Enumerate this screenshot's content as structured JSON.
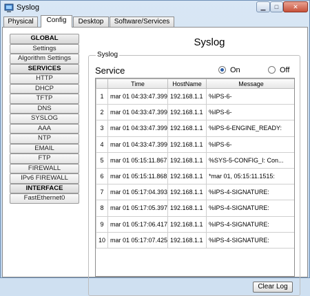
{
  "window": {
    "title": "Syslog",
    "icon": "syslog-app-icon",
    "controls": [
      "minimize",
      "maximize",
      "close"
    ]
  },
  "tabs": [
    {
      "label": "Physical"
    },
    {
      "label": "Config",
      "active": true
    },
    {
      "label": "Desktop"
    },
    {
      "label": "Software/Services"
    }
  ],
  "sidebar": {
    "items": [
      {
        "label": "GLOBAL",
        "header": true
      },
      {
        "label": "Settings"
      },
      {
        "label": "Algorithm Settings"
      },
      {
        "label": "SERVICES",
        "header": true
      },
      {
        "label": "HTTP"
      },
      {
        "label": "DHCP"
      },
      {
        "label": "TFTP"
      },
      {
        "label": "DNS"
      },
      {
        "label": "SYSLOG"
      },
      {
        "label": "AAA"
      },
      {
        "label": "NTP"
      },
      {
        "label": "EMAIL"
      },
      {
        "label": "FTP"
      },
      {
        "label": "FIREWALL"
      },
      {
        "label": "IPv6 FIREWALL"
      },
      {
        "label": "INTERFACE",
        "header": true
      },
      {
        "label": "FastEthernet0"
      }
    ]
  },
  "panel": {
    "title": "Syslog",
    "group_label": "Syslog",
    "service_label": "Service",
    "radio_on": "On",
    "radio_off": "Off",
    "selected": "On"
  },
  "table": {
    "headers": [
      "",
      "Time",
      "HostName",
      "Message"
    ],
    "rows": [
      {
        "idx": "1",
        "time": "mar 01 04:33:47.399",
        "host": "192.168.1.1",
        "message": "%IPS-6-"
      },
      {
        "idx": "2",
        "time": "mar 01 04:33:47.399",
        "host": "192.168.1.1",
        "message": "%IPS-6-"
      },
      {
        "idx": "3",
        "time": "mar 01 04:33:47.399",
        "host": "192.168.1.1",
        "message": "%IPS-6-ENGINE_READY:"
      },
      {
        "idx": "4",
        "time": "mar 01 04:33:47.399",
        "host": "192.168.1.1",
        "message": "%IPS-6-"
      },
      {
        "idx": "5",
        "time": "mar 01 05:15:11.867",
        "host": "192.168.1.1",
        "message": "%SYS-5-CONFIG_I: Con..."
      },
      {
        "idx": "6",
        "time": "mar 01 05:15:11.868",
        "host": "192.168.1.1",
        "message": "*mar 01, 05:15:11.1515:"
      },
      {
        "idx": "7",
        "time": "mar 01 05:17:04.393",
        "host": "192.168.1.1",
        "message": "%IPS-4-SIGNATURE:"
      },
      {
        "idx": "8",
        "time": "mar 01 05:17:05.397",
        "host": "192.168.1.1",
        "message": "%IPS-4-SIGNATURE:"
      },
      {
        "idx": "9",
        "time": "mar 01 05:17:06.417",
        "host": "192.168.1.1",
        "message": "%IPS-4-SIGNATURE:"
      },
      {
        "idx": "10",
        "time": "mar 01 05:17:07.425",
        "host": "192.168.1.1",
        "message": "%IPS-4-SIGNATURE:"
      }
    ]
  },
  "clear_button": "Clear Log",
  "colors": {
    "radio_selected": "#2b5ea8",
    "close_button": "#c7513a"
  }
}
